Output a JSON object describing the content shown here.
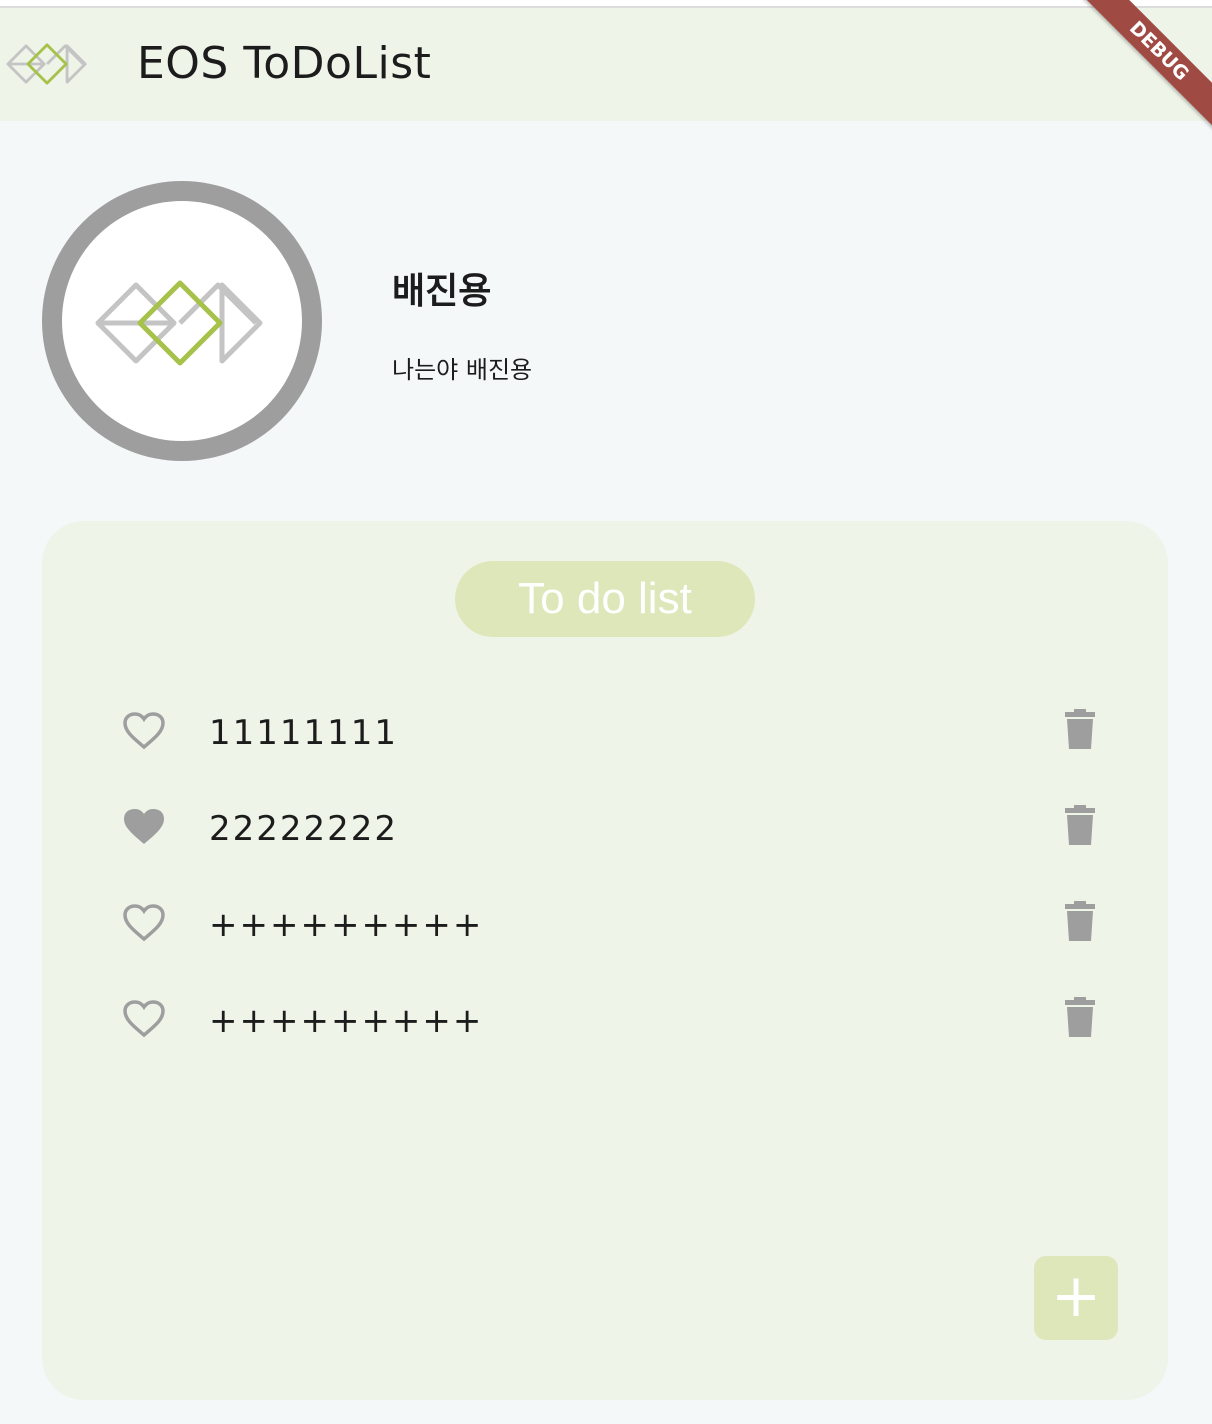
{
  "app_bar": {
    "title": "EOS ToDoList",
    "logo_icon": "eos-diamond-logo-icon",
    "debug_banner": "DEBUG"
  },
  "profile": {
    "avatar_icon": "eos-diamond-logo-icon",
    "name": "배진용",
    "bio": "나는야 배진용"
  },
  "todo": {
    "title": "To do list",
    "items": [
      {
        "text": "11111111",
        "liked": false
      },
      {
        "text": "22222222",
        "liked": true
      },
      {
        "text": "+++++++++",
        "liked": false
      },
      {
        "text": "+++++++++",
        "liked": false
      }
    ],
    "add_label": "+"
  },
  "colors": {
    "app_bar_bg": "#eff4e9",
    "page_bg": "#f5f8f9",
    "accent_light_green": "#dde7b9",
    "logo_green": "#a6c24a",
    "icon_gray": "#9e9e9e",
    "debug_red": "#a04a44"
  }
}
